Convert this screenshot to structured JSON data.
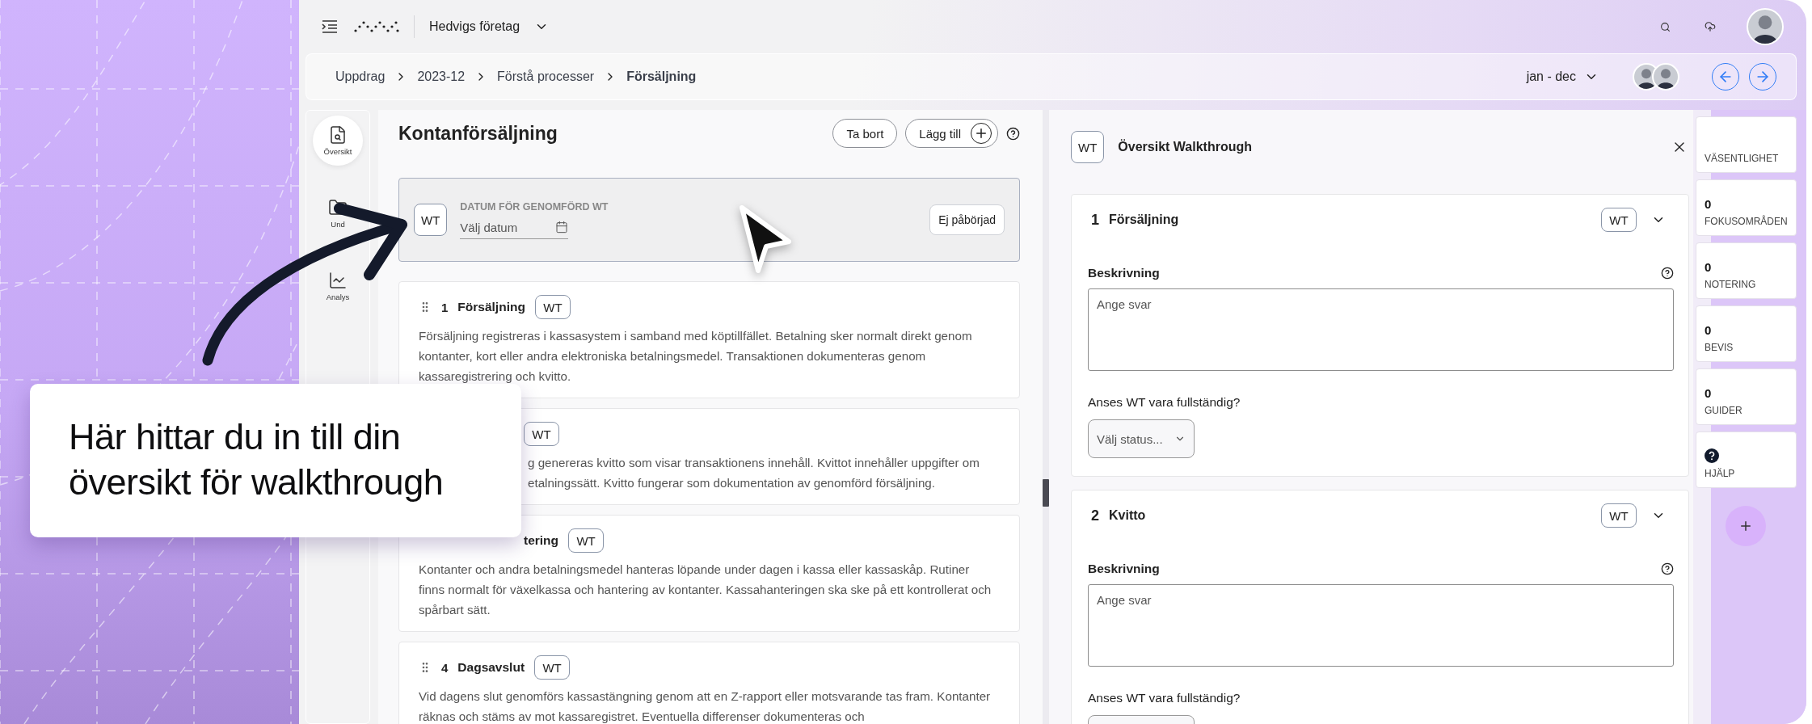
{
  "top_bar": {
    "company": "Hedvigs företag"
  },
  "breadcrumb": [
    {
      "label": "Uppdrag",
      "current": false
    },
    {
      "label": "2023-12",
      "current": false
    },
    {
      "label": "Förstå processer",
      "current": false
    },
    {
      "label": "Försäljning",
      "current": true
    }
  ],
  "period": "jan - dec",
  "nav": [
    {
      "kind": "overview",
      "label": "Översikt",
      "selected": true
    },
    {
      "kind": "folder",
      "label": "Und",
      "selected": false
    },
    {
      "kind": "chart",
      "label": "Analys",
      "selected": false
    }
  ],
  "main": {
    "title": "Kontanförsäljning",
    "buttons": [
      "Ta bort",
      "Lägg till"
    ],
    "date_card": {
      "badge": "WT",
      "label": "DATUM FÖR GENOMFÖRD WT",
      "placeholder": "Välj datum",
      "status": "Ej påbörjad"
    },
    "steps": [
      {
        "covered": false,
        "number": "1",
        "title": "Försäljning",
        "badge": "WT",
        "text": "Försäljning registreras i kassasystem i samband med köptillfället. Betalning sker normalt direkt genom kontanter, kort eller andra elektroniska betalningsmedel. Transaktionen dokumenteras genom kassaregistrering och kvitto."
      },
      {
        "covered": true,
        "badge": "WT",
        "lines": [
          "g genereras kvitto som visar transaktionens innehåll. Kvittot innehåller uppgifter om",
          "etalningssätt. Kvitto fungerar som dokumentation av genomförd försäljning."
        ]
      },
      {
        "covered": true,
        "title": "tering",
        "badge": "WT",
        "text": "Kontanter och andra betalningsmedel hanteras löpande under dagen i kassa eller kassaskåp. Rutiner finns normalt för växelkassa och hantering av kontanter. Kassahanteringen ska ske på ett kontrollerat och spårbart sätt."
      },
      {
        "covered": false,
        "number": "4",
        "title": "Dagsavslut",
        "badge": "WT",
        "text": "Vid dagens slut genomförs kassastängning genom att en Z-rapport eller motsvarande tas fram. Kontanter räknas och stäms av mot kassaregistret. Eventuella differenser dokumenteras och"
      }
    ]
  },
  "overview": {
    "badge": "WT",
    "title": "Översikt Walkthrough",
    "sections": [
      {
        "number": "1",
        "title": "Försäljning",
        "badge": "WT",
        "description_label": "Beskrivning",
        "placeholder": "Ange svar",
        "question": "Anses WT vara fullständig?",
        "select": "Välj status..."
      },
      {
        "number": "2",
        "title": "Kvitto",
        "badge": "WT",
        "description_label": "Beskrivning",
        "placeholder": "Ange svar",
        "question": "Anses WT vara fullständig?"
      }
    ]
  },
  "stats": [
    {
      "kind": "label",
      "label": "VÄSENTLIGHET"
    },
    {
      "kind": "count",
      "value": "0",
      "label": "FOKUSOMRÅDEN"
    },
    {
      "kind": "count",
      "value": "0",
      "label": "NOTERING"
    },
    {
      "kind": "count",
      "value": "0",
      "label": "BEVIS"
    },
    {
      "kind": "count",
      "value": "0",
      "label": "GUIDER"
    },
    {
      "kind": "help",
      "label": "HJÄLP"
    }
  ],
  "callout": {
    "text": "Här hittar du in till din översikt för walkthrough"
  }
}
